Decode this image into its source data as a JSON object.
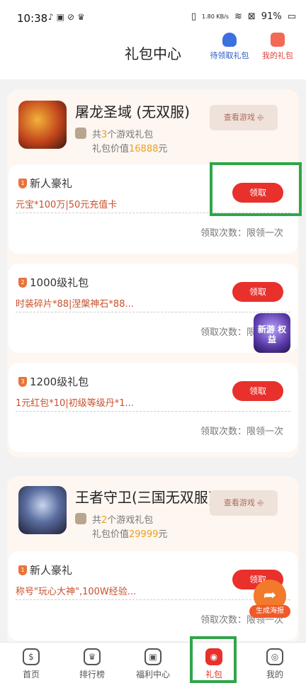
{
  "status": {
    "time": "10:38",
    "speed": "1.80 KB/s",
    "battery": "91%"
  },
  "header": {
    "title": "礼包中心",
    "pending_label": "待领取礼包",
    "mine_label": "我的礼包"
  },
  "games": [
    {
      "name": "屠龙圣域 (无双服)",
      "count_prefix": "共",
      "count": "3",
      "count_suffix": "个游戏礼包",
      "value_prefix": "礼包价值",
      "value": "16888",
      "value_suffix": "元",
      "view_label": "查看游戏 ⎆",
      "gifts": [
        {
          "num": "1",
          "title": "新人豪礼",
          "desc": "元宝*100万|50元充值卡",
          "count": "领取次数：限领一次",
          "claim": "领取"
        },
        {
          "num": "2",
          "title": "1000级礼包",
          "desc": "时装碎片*88|涅槃神石*88...",
          "count": "领取次数：限领一次",
          "claim": "领取"
        },
        {
          "num": "3",
          "title": "1200级礼包",
          "desc": "1元红包*10|初级等级丹*1...",
          "count": "领取次数：限领一次",
          "claim": "领取"
        }
      ]
    },
    {
      "name": "王者守卫(三国无双服)",
      "count_prefix": "共",
      "count": "2",
      "count_suffix": "个游戏礼包",
      "value_prefix": "礼包价值",
      "value": "29999",
      "value_suffix": "元",
      "view_label": "查看游戏 ⎆",
      "gifts": [
        {
          "num": "1",
          "title": "新人豪礼",
          "desc": "称号\"玩心大神\",100W经验...",
          "count": "领取次数：限领一次",
          "claim": "领取"
        }
      ]
    }
  ],
  "float_ad": "新游 权益",
  "poster_label": "生成海报",
  "tabs": [
    {
      "label": "首页",
      "icon": "$"
    },
    {
      "label": "排行榜",
      "icon": "♛"
    },
    {
      "label": "福利中心",
      "icon": "▣"
    },
    {
      "label": "礼包",
      "icon": "◉"
    },
    {
      "label": "我的",
      "icon": "◎"
    }
  ]
}
